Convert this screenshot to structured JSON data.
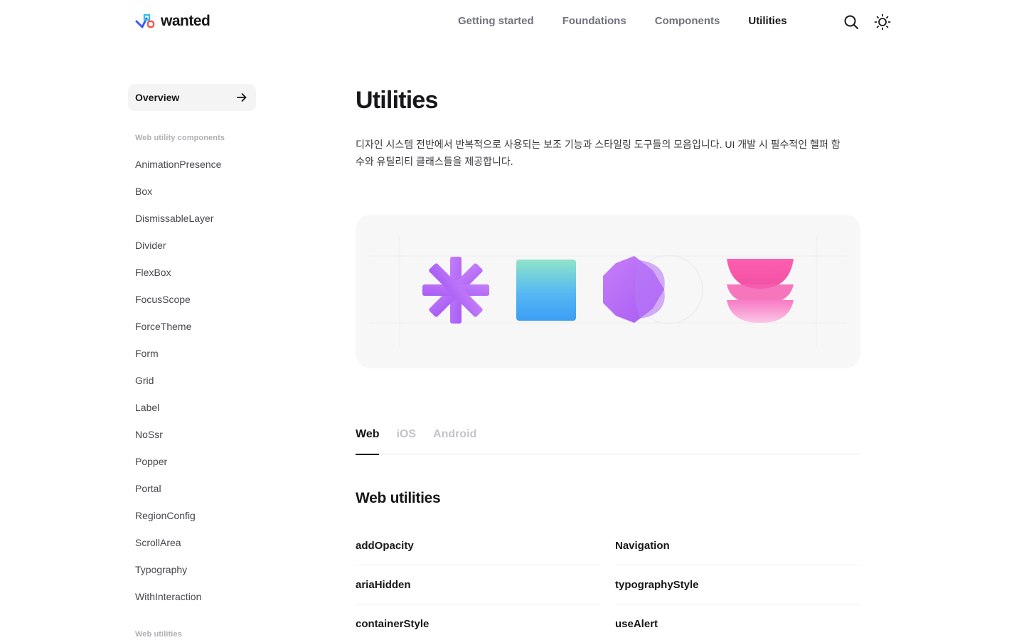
{
  "brand": {
    "name": "wanted"
  },
  "topnav": {
    "items": [
      {
        "label": "Getting started"
      },
      {
        "label": "Foundations"
      },
      {
        "label": "Components"
      },
      {
        "label": "Utilities"
      }
    ]
  },
  "header": {
    "icons": [
      "search-icon",
      "sun-icon"
    ]
  },
  "sidebar": {
    "overview_label": "Overview",
    "section1_title": "Web utility components",
    "items": [
      "AnimationPresence",
      "Box",
      "DismissableLayer",
      "Divider",
      "FlexBox",
      "FocusScope",
      "ForceTheme",
      "Form",
      "Grid",
      "Label",
      "NoSsr",
      "Popper",
      "Portal",
      "RegionConfig",
      "ScrollArea",
      "Typography",
      "WithInteraction"
    ],
    "section2_title": "Web utilities"
  },
  "main": {
    "title": "Utilities",
    "description": "디자인 시스템 전반에서 반복적으로 사용되는 보조 기능과 스타일링 도구들의 모음입니다. UI 개발 시 필수적인 헬퍼 함수와 유틸리티 클래스들을 제공합니다.",
    "tabs": [
      "Web",
      "iOS",
      "Android"
    ],
    "section_title": "Web utilities",
    "utilities": [
      "addOpacity",
      "Navigation",
      "ariaHidden",
      "typographyStyle",
      "containerStyle",
      "useAlert"
    ]
  },
  "colors": {
    "accent_purple": "#b56cf7",
    "accent_blue": "#3b9ef5",
    "accent_pink": "#f04fa3"
  }
}
